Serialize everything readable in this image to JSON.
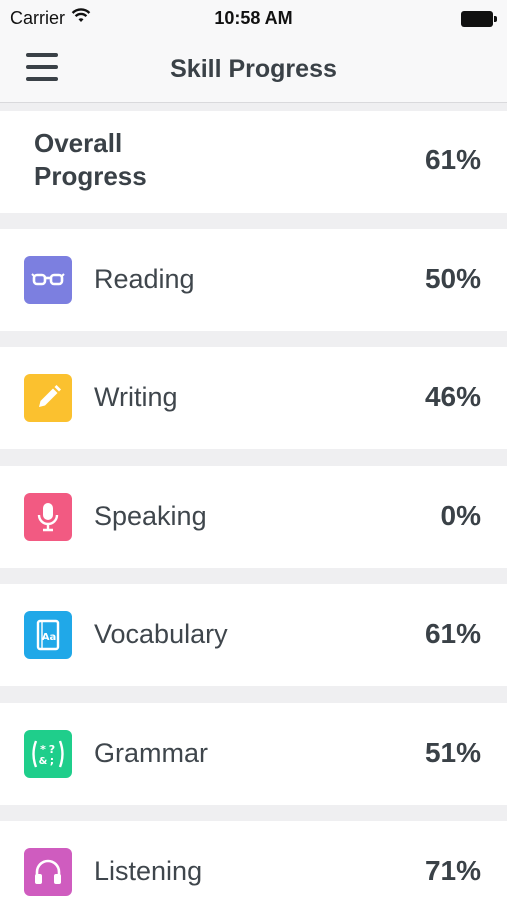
{
  "status_bar": {
    "carrier": "Carrier",
    "time": "10:58 AM",
    "wifi_icon": "wifi-icon",
    "battery_icon": "battery-icon"
  },
  "header": {
    "title": "Skill Progress",
    "menu_icon": "hamburger-menu-icon"
  },
  "overall": {
    "label": "Overall Progress",
    "value": "61%"
  },
  "skills": [
    {
      "label": "Reading",
      "value": "50%",
      "icon": "glasses-icon",
      "color": "#7c7fe0"
    },
    {
      "label": "Writing",
      "value": "46%",
      "icon": "pencil-icon",
      "color": "#fbc12f"
    },
    {
      "label": "Speaking",
      "value": "0%",
      "icon": "microphone-icon",
      "color": "#f25a82"
    },
    {
      "label": "Vocabulary",
      "value": "61%",
      "icon": "dictionary-icon",
      "color": "#20a8e8"
    },
    {
      "label": "Grammar",
      "value": "51%",
      "icon": "grammar-symbols-icon",
      "color": "#1fce8b"
    },
    {
      "label": "Listening",
      "value": "71%",
      "icon": "headphones-icon",
      "color": "#cf5cbf"
    }
  ],
  "colors": {
    "background": "#efeff1",
    "row_background": "#ffffff",
    "text": "#3a4147"
  }
}
